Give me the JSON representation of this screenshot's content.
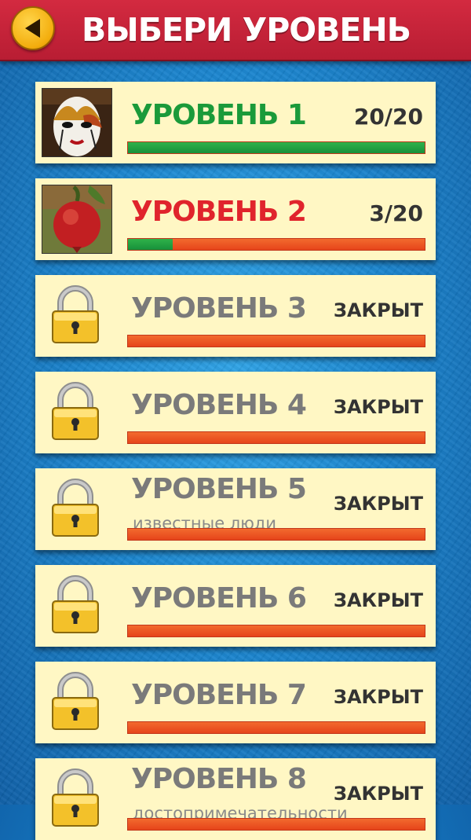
{
  "header": {
    "title": "ВЫБЕРИ УРОВЕНЬ"
  },
  "levels": [
    {
      "title": "УРОВЕНЬ 1",
      "subtitle": "",
      "score": "20/20",
      "progress": 1.0,
      "unlocked": true,
      "title_color": "#1a9a3a",
      "image": "mask"
    },
    {
      "title": "УРОВЕНЬ 2",
      "subtitle": "",
      "score": "3/20",
      "progress": 0.15,
      "unlocked": true,
      "title_color": "#e0242c",
      "image": "pomegranate"
    },
    {
      "title": "УРОВЕНЬ 3",
      "subtitle": "",
      "score": "ЗАКРЫТ",
      "progress": 0,
      "unlocked": false,
      "title_color": "#7a7a7a"
    },
    {
      "title": "УРОВЕНЬ 4",
      "subtitle": "",
      "score": "ЗАКРЫТ",
      "progress": 0,
      "unlocked": false,
      "title_color": "#7a7a7a"
    },
    {
      "title": "УРОВЕНЬ 5",
      "subtitle": "известные люди",
      "score": "ЗАКРЫТ",
      "progress": 0,
      "unlocked": false,
      "title_color": "#7a7a7a"
    },
    {
      "title": "УРОВЕНЬ 6",
      "subtitle": "",
      "score": "ЗАКРЫТ",
      "progress": 0,
      "unlocked": false,
      "title_color": "#7a7a7a"
    },
    {
      "title": "УРОВЕНЬ 7",
      "subtitle": "",
      "score": "ЗАКРЫТ",
      "progress": 0,
      "unlocked": false,
      "title_color": "#7a7a7a"
    },
    {
      "title": "УРОВЕНЬ 8",
      "subtitle": "достопримечательности",
      "score": "ЗАКРЫТ",
      "progress": 0,
      "unlocked": false,
      "title_color": "#7a7a7a"
    }
  ],
  "colors": {
    "header_red": "#c8233a",
    "card_bg": "#fff7c4",
    "progress_green": "#1f9e3f",
    "progress_orange": "#ec5a22"
  }
}
